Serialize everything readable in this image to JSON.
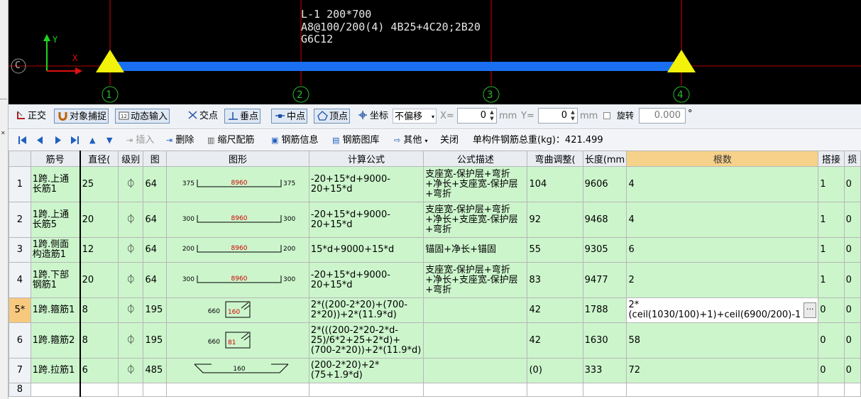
{
  "canvas": {
    "beam_text": [
      "L-1 200*700",
      "A8@100/200(4) 4B25+4C20;2B20",
      "G6C12"
    ],
    "axis_labels": [
      "1",
      "2",
      "3",
      "4"
    ],
    "y_axis": "Y",
    "x_axis": "X",
    "corner_label": "C"
  },
  "snapbar": {
    "ortho": "正交",
    "object_snap": "对象捕捉",
    "dynamic_input": "动态输入",
    "intersection": "交点",
    "perpendicular": "垂点",
    "midpoint": "中点",
    "vertex": "顶点",
    "coordinate": "坐标",
    "offset_select": "不偏移",
    "x_label": "X=",
    "x_value": "0",
    "x_unit": "mm",
    "y_label": "Y=",
    "y_value": "0",
    "y_unit": "mm",
    "rotate_label": "旋转",
    "rotate_value": "0.000",
    "degree": "°"
  },
  "rebarbar": {
    "insert": "插入",
    "delete": "删除",
    "scale_rebar": "缩尺配筋",
    "rebar_info": "钢筋信息",
    "rebar_library": "钢筋图库",
    "other": "其他",
    "close": "关闭",
    "total_weight": "单构件钢筋总重(kg)：421.499"
  },
  "grid": {
    "headers": [
      "",
      "筋号",
      "直径(",
      "级别",
      "图",
      "图形",
      "计算公式",
      "公式描述",
      "弯曲调整(",
      "长度(mm",
      "根数",
      "搭接",
      "损"
    ],
    "rows": [
      {
        "n": "1",
        "name": "1跨.上通长筋1",
        "dia": "25",
        "grade": "⏀",
        "fig": "64",
        "shape": {
          "type": "u",
          "left": "375",
          "mid": "8960",
          "right": "375"
        },
        "formula": "-20+15*d+9000-20+15*d",
        "desc": "支座宽-保护层+弯折+净长+支座宽-保护层+弯折",
        "bend": "104",
        "len": "9606",
        "count": "4",
        "lap": "1",
        "loss": "0"
      },
      {
        "n": "2",
        "name": "1跨.上通长筋5",
        "dia": "20",
        "grade": "⏀",
        "fig": "64",
        "shape": {
          "type": "u",
          "left": "300",
          "mid": "8960",
          "right": "300"
        },
        "formula": "-20+15*d+9000-20+15*d",
        "desc": "支座宽-保护层+弯折+净长+支座宽-保护层+弯折",
        "bend": "92",
        "len": "9468",
        "count": "4",
        "lap": "1",
        "loss": "0"
      },
      {
        "n": "3",
        "name": "1跨.侧面构造筋1",
        "dia": "12",
        "grade": "⏀",
        "fig": "64",
        "shape": {
          "type": "u",
          "left": "200",
          "mid": "8960",
          "right": "200"
        },
        "formula": "15*d+9000+15*d",
        "desc": "锚固+净长+锚固",
        "bend": "55",
        "len": "9305",
        "count": "6",
        "lap": "1",
        "loss": "0"
      },
      {
        "n": "4",
        "name": "1跨.下部钢筋1",
        "dia": "20",
        "grade": "⏀",
        "fig": "64",
        "shape": {
          "type": "u",
          "left": "300",
          "mid": "8960",
          "right": "300"
        },
        "formula": "-20+15*d+9000-20+15*d",
        "desc": "支座宽-保护层+弯折+净长+支座宽-保护层+弯折",
        "bend": "83",
        "len": "9477",
        "count": "2",
        "lap": "1",
        "loss": "0"
      },
      {
        "n": "5*",
        "name": "1跨.箍筋1",
        "dia": "8",
        "grade": "⏀",
        "fig": "195",
        "shape": {
          "type": "stirrup",
          "left": "660",
          "mid": "160"
        },
        "formula": "2*((200-2*20)+(700-2*20))+2*(11.9*d)",
        "desc": "",
        "bend": "42",
        "len": "1788",
        "count": "2*(ceil(1030/100)+1)+ceil(6900/200)-1",
        "lap": "0",
        "loss": "0"
      },
      {
        "n": "6",
        "name": "1跨.箍筋2",
        "dia": "8",
        "grade": "⏀",
        "fig": "195",
        "shape": {
          "type": "stirrup",
          "left": "660",
          "mid": "81"
        },
        "formula": "2*(((200-2*20-2*d-25)/6*2+25+2*d)+(700-2*20))+2*(11.9*d)",
        "desc": "",
        "bend": "42",
        "len": "1630",
        "count": "58",
        "lap": "0",
        "loss": "0"
      },
      {
        "n": "7",
        "name": "1跨.拉筋1",
        "dia": "6",
        "grade": "⏀",
        "fig": "485",
        "shape": {
          "type": "tie",
          "mid": "160"
        },
        "formula": "(200-2*20)+2*(75+1.9*d)",
        "desc": "",
        "bend": "(0)",
        "len": "333",
        "count": "72",
        "lap": "0",
        "loss": "0"
      },
      {
        "n": "8",
        "name": "",
        "dia": "",
        "grade": "",
        "fig": "",
        "shape": {
          "type": "none"
        },
        "formula": "",
        "desc": "",
        "bend": "",
        "len": "",
        "count": "",
        "lap": "",
        "loss": ""
      }
    ]
  },
  "colors": {
    "canvas_bg": "#000000",
    "beam": "#1a6ff0",
    "support": "#f2f20a",
    "axis": "#d40000",
    "row_bg": "#ccf5cc",
    "active_header": "#f6d18a"
  }
}
